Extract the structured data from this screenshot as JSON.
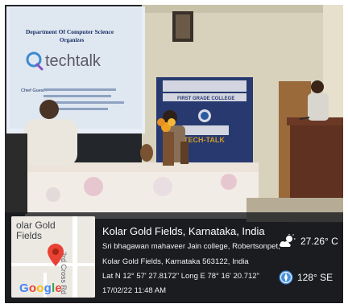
{
  "projection": {
    "heading": "Department Of Computer Science",
    "subheading": "Organizes",
    "event_name": "techtalk",
    "chief_guest_label": "Chief Guest :"
  },
  "banner": {
    "college_title": "FIRST GRADE COLLEGE",
    "event": "TECH-TALK"
  },
  "map": {
    "place_label": "olar Gold\nFields",
    "road_label": "3rd Cross Rd",
    "logo_text": "Google",
    "logo_colors": [
      "#4285F4",
      "#EA4335",
      "#FBBC05",
      "#4285F4",
      "#34A853",
      "#EA4335"
    ],
    "pin_icon": "location-pin-icon"
  },
  "location": {
    "title": "Kolar Gold Fields, Karnataka, India",
    "address_line1": "Sri bhagawan mahaveer Jain college, Robertsonpet,",
    "address_line2": "Kolar Gold Fields, Karnataka 563122, India",
    "coordinates": "Lat N 12° 57' 27.8172\" Long E 78° 16' 20.712\"",
    "timestamp": "17/02/22 11:48 AM"
  },
  "weather": {
    "icon": "partly-cloudy-icon",
    "temperature": "27.26° C"
  },
  "wind": {
    "icon": "compass-icon",
    "direction": "128° SE"
  }
}
